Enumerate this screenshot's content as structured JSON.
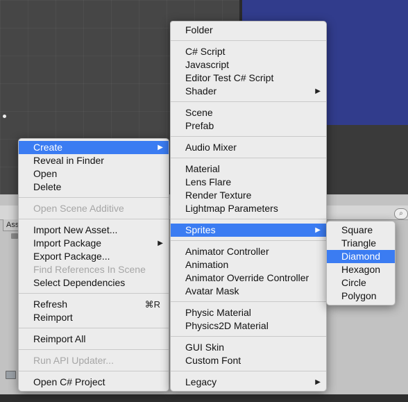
{
  "background": {
    "project_tab_label": "Ass",
    "search_icon": "search-icon"
  },
  "main_menu": {
    "items": [
      {
        "label": "Create",
        "selected": true,
        "has_submenu": true
      },
      {
        "label": "Reveal in Finder"
      },
      {
        "label": "Open"
      },
      {
        "label": "Delete"
      },
      {
        "separator": true
      },
      {
        "label": "Open Scene Additive",
        "disabled": true
      },
      {
        "separator": true
      },
      {
        "label": "Import New Asset..."
      },
      {
        "label": "Import Package",
        "has_submenu": true
      },
      {
        "label": "Export Package..."
      },
      {
        "label": "Find References In Scene",
        "disabled": true
      },
      {
        "label": "Select Dependencies"
      },
      {
        "separator": true
      },
      {
        "label": "Refresh",
        "shortcut": "⌘R"
      },
      {
        "label": "Reimport"
      },
      {
        "separator": true
      },
      {
        "label": "Reimport All"
      },
      {
        "separator": true
      },
      {
        "label": "Run API Updater...",
        "disabled": true
      },
      {
        "separator": true
      },
      {
        "label": "Open C# Project"
      }
    ]
  },
  "create_menu": {
    "items": [
      {
        "label": "Folder"
      },
      {
        "separator": true
      },
      {
        "label": "C# Script"
      },
      {
        "label": "Javascript"
      },
      {
        "label": "Editor Test C# Script"
      },
      {
        "label": "Shader",
        "has_submenu": true
      },
      {
        "separator": true
      },
      {
        "label": "Scene"
      },
      {
        "label": "Prefab"
      },
      {
        "separator": true
      },
      {
        "label": "Audio Mixer"
      },
      {
        "separator": true
      },
      {
        "label": "Material"
      },
      {
        "label": "Lens Flare"
      },
      {
        "label": "Render Texture"
      },
      {
        "label": "Lightmap Parameters"
      },
      {
        "separator": true
      },
      {
        "label": "Sprites",
        "selected": true,
        "has_submenu": true
      },
      {
        "separator": true
      },
      {
        "label": "Animator Controller"
      },
      {
        "label": "Animation"
      },
      {
        "label": "Animator Override Controller"
      },
      {
        "label": "Avatar Mask"
      },
      {
        "separator": true
      },
      {
        "label": "Physic Material"
      },
      {
        "label": "Physics2D Material"
      },
      {
        "separator": true
      },
      {
        "label": "GUI Skin"
      },
      {
        "label": "Custom Font"
      },
      {
        "separator": true
      },
      {
        "label": "Legacy",
        "has_submenu": true
      }
    ]
  },
  "sprites_menu": {
    "items": [
      {
        "label": "Square"
      },
      {
        "label": "Triangle"
      },
      {
        "label": "Diamond",
        "selected": true
      },
      {
        "label": "Hexagon"
      },
      {
        "label": "Circle"
      },
      {
        "label": "Polygon"
      }
    ]
  },
  "colors": {
    "highlight": "#3b7cf2",
    "menu_bg": "#ececec",
    "disabled_text": "#a6a6a6",
    "game_view_bg": "#313c8c"
  },
  "icons": {
    "submenu_arrow": "submenu-arrow-icon"
  }
}
